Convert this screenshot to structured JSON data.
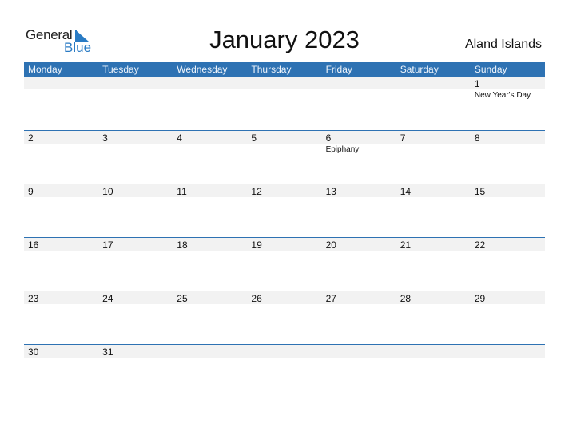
{
  "logo": {
    "text_general": "General",
    "text_blue": "Blue",
    "accent": "#2a7bc4"
  },
  "title": "January 2023",
  "country": "Aland Islands",
  "colors": {
    "header_bg": "#2e72b3",
    "row_band": "#f2f2f2"
  },
  "weekdays": [
    "Monday",
    "Tuesday",
    "Wednesday",
    "Thursday",
    "Friday",
    "Saturday",
    "Sunday"
  ],
  "weeks": [
    [
      {
        "day": ""
      },
      {
        "day": ""
      },
      {
        "day": ""
      },
      {
        "day": ""
      },
      {
        "day": ""
      },
      {
        "day": ""
      },
      {
        "day": "1",
        "holiday": "New Year's Day"
      }
    ],
    [
      {
        "day": "2"
      },
      {
        "day": "3"
      },
      {
        "day": "4"
      },
      {
        "day": "5"
      },
      {
        "day": "6",
        "holiday": "Epiphany"
      },
      {
        "day": "7"
      },
      {
        "day": "8"
      }
    ],
    [
      {
        "day": "9"
      },
      {
        "day": "10"
      },
      {
        "day": "11"
      },
      {
        "day": "12"
      },
      {
        "day": "13"
      },
      {
        "day": "14"
      },
      {
        "day": "15"
      }
    ],
    [
      {
        "day": "16"
      },
      {
        "day": "17"
      },
      {
        "day": "18"
      },
      {
        "day": "19"
      },
      {
        "day": "20"
      },
      {
        "day": "21"
      },
      {
        "day": "22"
      }
    ],
    [
      {
        "day": "23"
      },
      {
        "day": "24"
      },
      {
        "day": "25"
      },
      {
        "day": "26"
      },
      {
        "day": "27"
      },
      {
        "day": "28"
      },
      {
        "day": "29"
      }
    ],
    [
      {
        "day": "30"
      },
      {
        "day": "31"
      },
      {
        "day": ""
      },
      {
        "day": ""
      },
      {
        "day": ""
      },
      {
        "day": ""
      },
      {
        "day": ""
      }
    ]
  ]
}
